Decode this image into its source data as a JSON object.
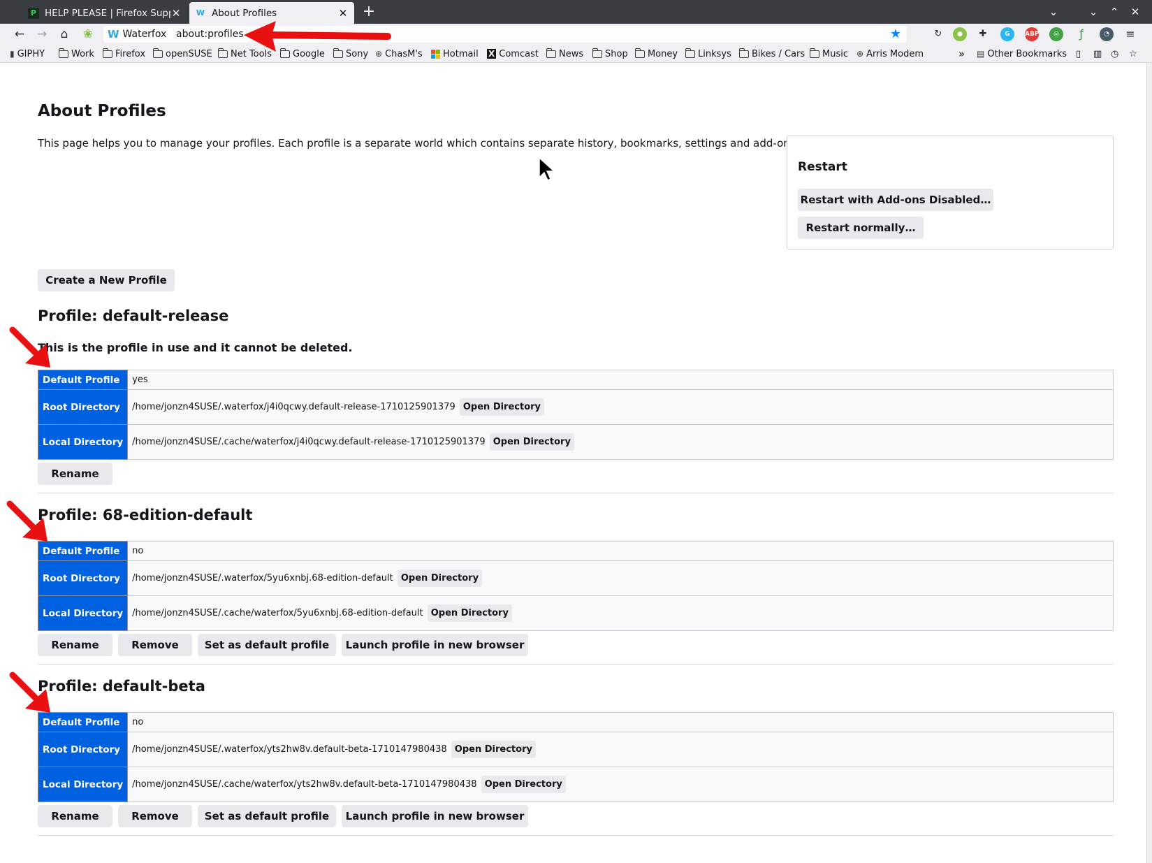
{
  "tabs": [
    {
      "title": "HELP PLEASE | Firefox Suppo",
      "favicon": "firefox-support-icon"
    },
    {
      "title": "About Profiles",
      "favicon": "waterfox-icon"
    }
  ],
  "urlbar": {
    "identity": "Waterfox",
    "url": "about:profiles"
  },
  "bookmarks": [
    "GIPHY",
    "Work",
    "Firefox",
    "openSUSE",
    "Net Tools",
    "Google",
    "Sony",
    "ChasM's",
    "Hotmail",
    "Comcast",
    "News",
    "Shop",
    "Money",
    "Linksys",
    "Bikes / Cars",
    "Music",
    "Arris Modem"
  ],
  "other_bookmarks": "Other Bookmarks",
  "page": {
    "title": "About Profiles",
    "intro": "This page helps you to manage your profiles. Each profile is a separate world which contains separate history, bookmarks, settings and add-ons.",
    "restart_title": "Restart",
    "restart_addons": "Restart with Add-ons Disabled…",
    "restart_normally": "Restart normally…",
    "create_profile": "Create a New Profile"
  },
  "labels": {
    "default_profile": "Default Profile",
    "root_directory": "Root Directory",
    "local_directory": "Local Directory",
    "open_directory": "Open Directory",
    "rename": "Rename",
    "remove": "Remove",
    "set_default": "Set as default profile",
    "launch": "Launch profile in new browser"
  },
  "profiles": [
    {
      "heading": "Profile: default-release",
      "in_use_note": "This is the profile in use and it cannot be deleted.",
      "default": "yes",
      "root": "/home/jonzn4SUSE/.waterfox/j4i0qcwy.default-release-1710125901379",
      "local": "/home/jonzn4SUSE/.cache/waterfox/j4i0qcwy.default-release-1710125901379"
    },
    {
      "heading": "Profile: 68-edition-default",
      "default": "no",
      "root": "/home/jonzn4SUSE/.waterfox/5yu6xnbj.68-edition-default",
      "local": "/home/jonzn4SUSE/.cache/waterfox/5yu6xnbj.68-edition-default"
    },
    {
      "heading": "Profile: default-beta",
      "default": "no",
      "root": "/home/jonzn4SUSE/.waterfox/yts2hw8v.default-beta-1710147980438",
      "local": "/home/jonzn4SUSE/.cache/waterfox/yts2hw8v.default-beta-1710147980438"
    }
  ],
  "colors": {
    "accent": "#0061e0",
    "annotation": "#e81010"
  }
}
